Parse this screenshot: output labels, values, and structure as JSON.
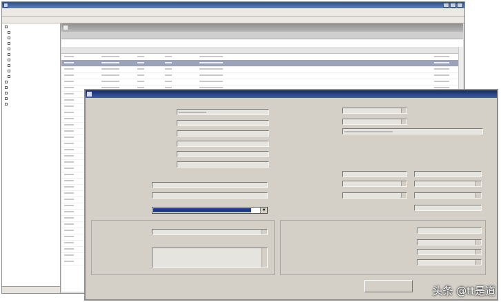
{
  "watermark": "头条 @tt是道"
}
